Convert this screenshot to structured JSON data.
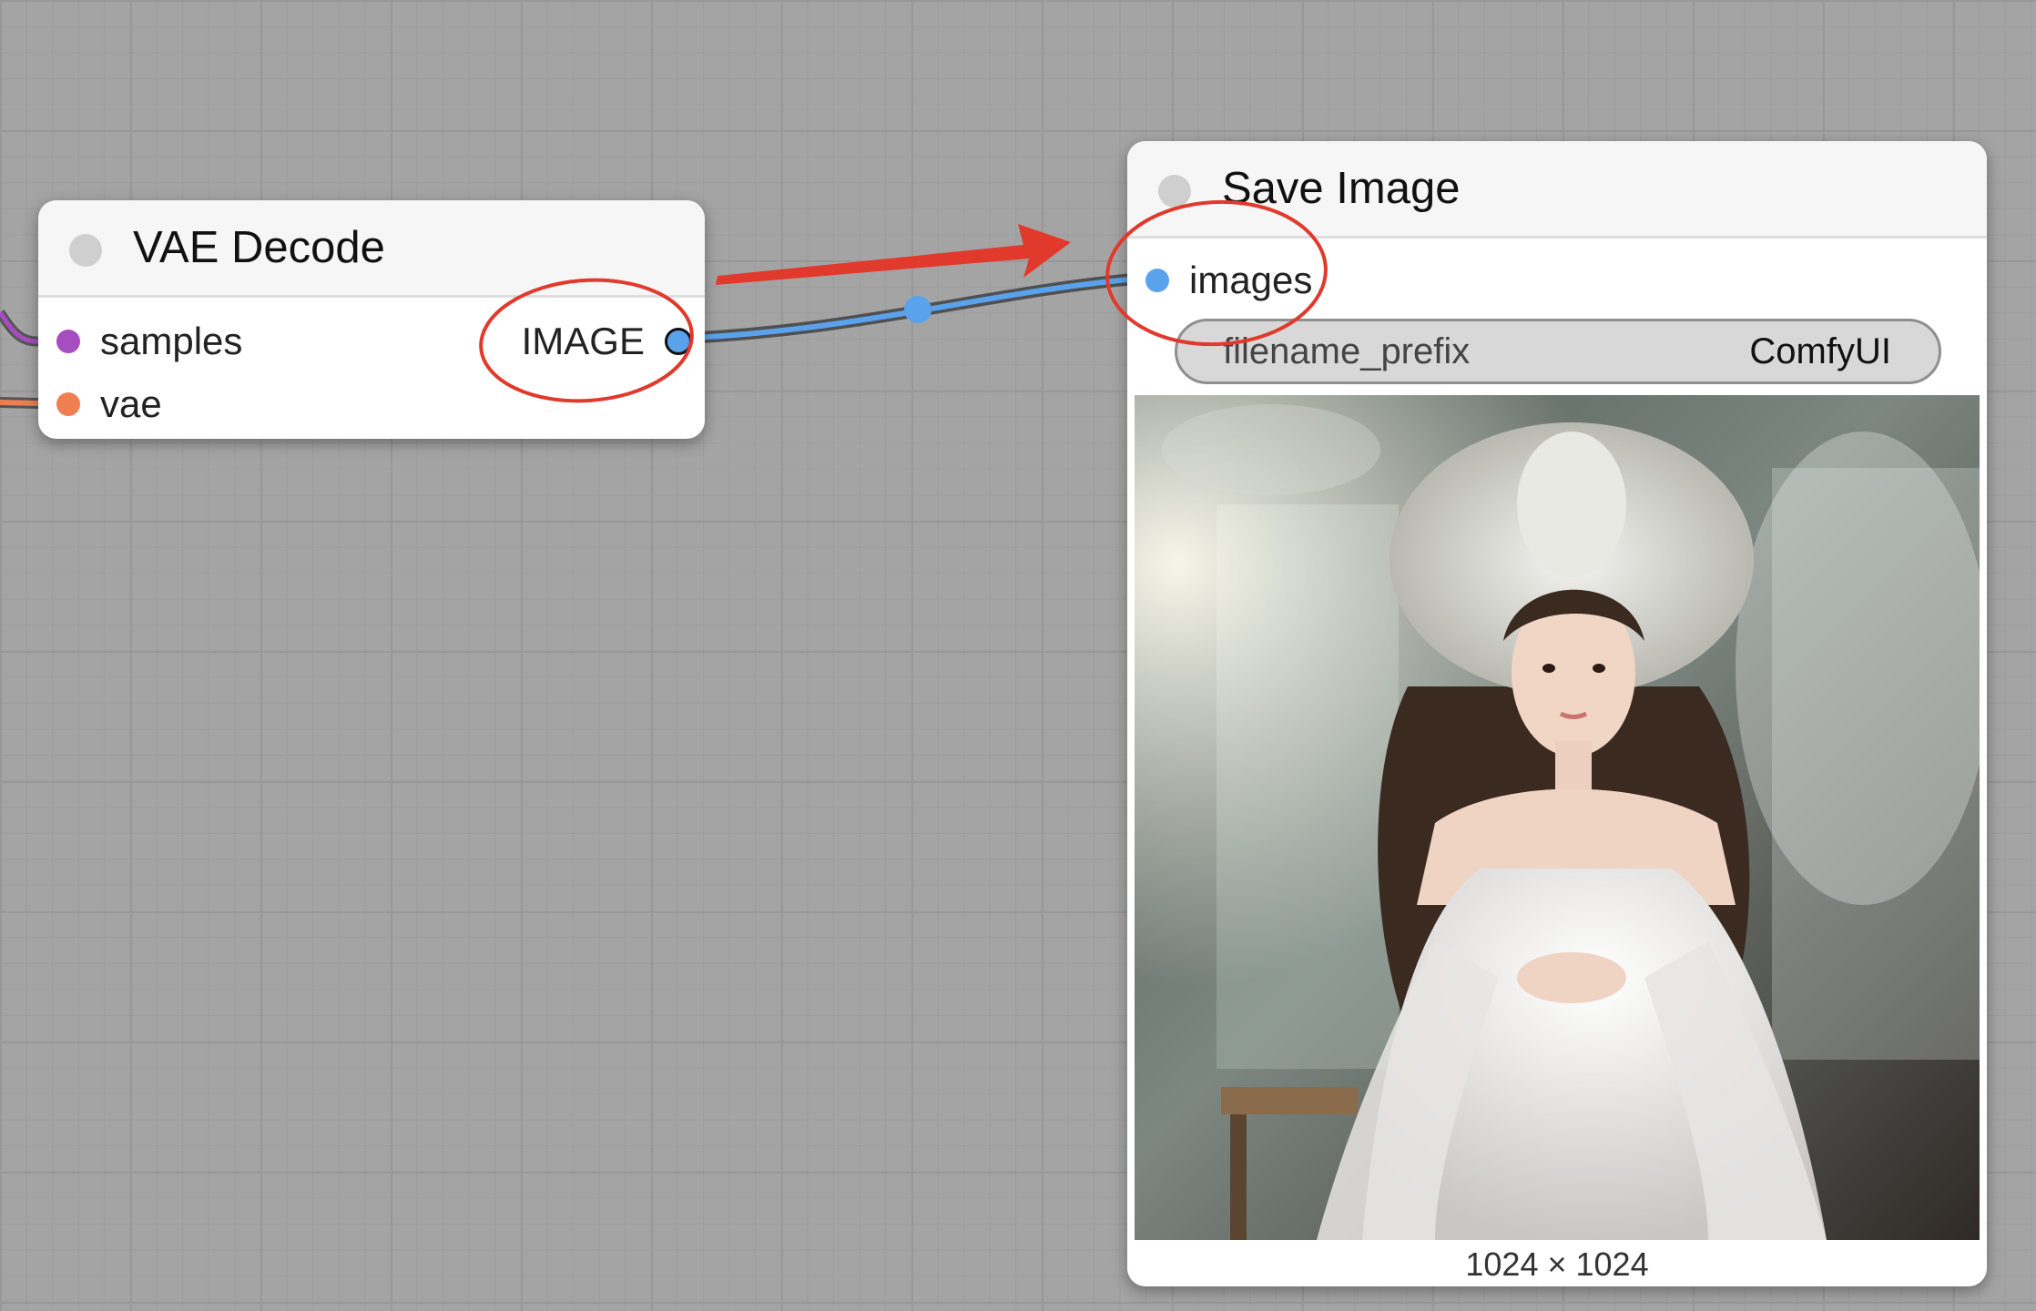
{
  "canvas": {
    "background": "#a4a4a4"
  },
  "nodes": {
    "vae_decode": {
      "title": "VAE Decode",
      "inputs": [
        {
          "label": "samples",
          "color": "#a54dc1"
        },
        {
          "label": "vae",
          "color": "#ef7f50"
        }
      ],
      "output": {
        "label": "IMAGE",
        "color": "#5aa2ec"
      }
    },
    "save_image": {
      "title": "Save Image",
      "input": {
        "label": "images",
        "color": "#5aa2ec"
      },
      "widget": {
        "name": "filename_prefix",
        "value": "ComfyUI"
      },
      "preview": {
        "description_icon": "image-preview",
        "dimensions": "1024 × 1024"
      }
    }
  },
  "annotations": {
    "color": "#e1392b",
    "icons": [
      "arrow-annotation",
      "circle-annotation"
    ]
  },
  "link_colors": {
    "image": "#5aa2ec",
    "latent": "#a54dc1",
    "vae": "#ef7f50"
  }
}
